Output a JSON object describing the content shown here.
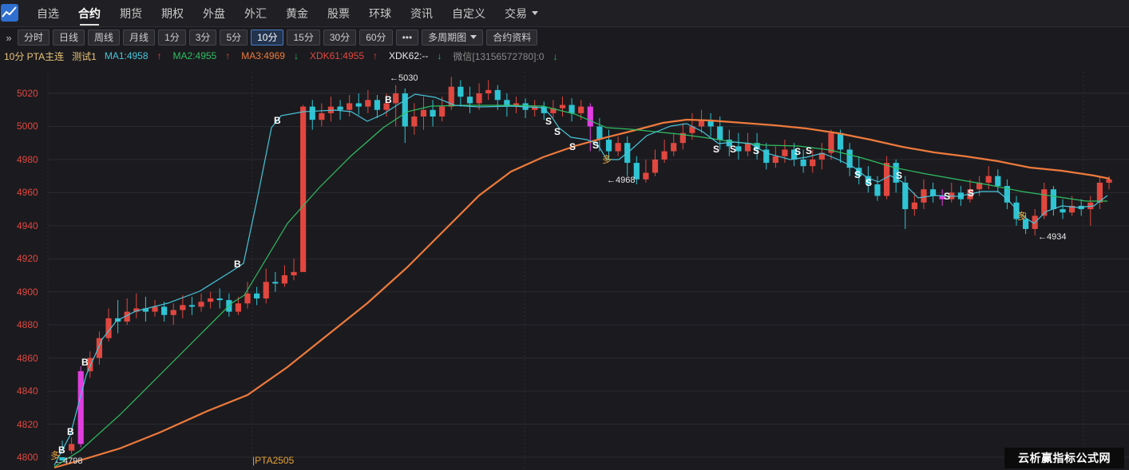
{
  "nav": {
    "items": [
      "自选",
      "合约",
      "期货",
      "期权",
      "外盘",
      "外汇",
      "黄金",
      "股票",
      "环球",
      "资讯",
      "自定义",
      "交易"
    ],
    "active": "合约"
  },
  "toolbar": {
    "periods": [
      "分时",
      "日线",
      "周线",
      "月线",
      "1分",
      "3分",
      "5分",
      "10分",
      "15分",
      "30分",
      "60分"
    ],
    "active_period": "10分",
    "more": "•••",
    "multi_period": "多周期图",
    "contract_info": "合约资料"
  },
  "indicator": {
    "title": "10分 PTA主连",
    "test": "测试1",
    "ma1": "MA1:4958",
    "ma2": "MA2:4955",
    "ma3": "MA3:4969",
    "xdk61": "XDK61:4955",
    "xdk62": "XDK62:--",
    "wechat": "微信[13156572780]:0"
  },
  "colors": {
    "up": "#e0473f",
    "down": "#2ec4d4",
    "ma1": "#48c4d8",
    "ma2": "#2fbf62",
    "ma3": "#ee7a3c",
    "magenta": "#e13ee0",
    "signal_yellow": "#e6a13a"
  },
  "annotations": {
    "high": "←5030",
    "low_left": "←4798",
    "low_mid": "←4968",
    "low_right": "←4934"
  },
  "contract_tag": "PTA2505",
  "watermark": "云析赢指标公式网",
  "chart_data": {
    "type": "candlestick",
    "ylim": [
      4795,
      5035
    ],
    "yticks": [
      4800,
      4820,
      4840,
      4860,
      4880,
      4900,
      4920,
      4940,
      4960,
      4980,
      5000,
      5020
    ],
    "candles": [
      [
        4800,
        4798,
        4804,
        4810
      ],
      [
        4804,
        4808,
        4802,
        4812
      ],
      [
        4808,
        4852,
        4806,
        4855
      ],
      [
        4852,
        4860,
        4848,
        4864
      ],
      [
        4860,
        4872,
        4856,
        4876
      ],
      [
        4872,
        4884,
        4870,
        4890
      ],
      [
        4884,
        4882,
        4875,
        4895
      ],
      [
        4882,
        4888,
        4880,
        4896
      ],
      [
        4888,
        4890,
        4884,
        4899
      ],
      [
        4890,
        4888,
        4882,
        4897
      ],
      [
        4888,
        4891,
        4885,
        4895
      ],
      [
        4891,
        4886,
        4882,
        4894
      ],
      [
        4886,
        4889,
        4880,
        4893
      ],
      [
        4889,
        4892,
        4884,
        4898
      ],
      [
        4892,
        4891,
        4886,
        4897
      ],
      [
        4891,
        4894,
        4888,
        4899
      ],
      [
        4894,
        4896,
        4890,
        4900
      ],
      [
        4896,
        4895,
        4890,
        4902
      ],
      [
        4895,
        4888,
        4885,
        4899
      ],
      [
        4888,
        4893,
        4886,
        4897
      ],
      [
        4893,
        4899,
        4890,
        4906
      ],
      [
        4899,
        4896,
        4892,
        4903
      ],
      [
        4896,
        4906,
        4893,
        4914
      ],
      [
        4906,
        4905,
        4900,
        4912
      ],
      [
        4905,
        4910,
        4903,
        4916
      ],
      [
        4910,
        4912,
        4907,
        4920
      ],
      [
        4912,
        5012,
        4985,
        5013
      ],
      [
        5012,
        5004,
        4998,
        5016
      ],
      [
        5004,
        5008,
        5000,
        5014
      ],
      [
        5008,
        5012,
        5003,
        5018
      ],
      [
        5012,
        5010,
        5004,
        5016
      ],
      [
        5010,
        5014,
        5006,
        5019
      ],
      [
        5014,
        5012,
        5007,
        5020
      ],
      [
        5012,
        5016,
        5008,
        5022
      ],
      [
        5016,
        5010,
        5005,
        5019
      ],
      [
        5010,
        5014,
        5006,
        5020
      ],
      [
        5014,
        5020,
        5000,
        5025
      ],
      [
        5020,
        5000,
        4990,
        5023
      ],
      [
        5000,
        5006,
        4995,
        5014
      ],
      [
        5006,
        5010,
        4998,
        5018
      ],
      [
        5010,
        5006,
        5000,
        5016
      ],
      [
        5006,
        5012,
        5003,
        5018
      ],
      [
        5012,
        5024,
        5010,
        5030
      ],
      [
        5024,
        5018,
        5012,
        5028
      ],
      [
        5018,
        5014,
        5008,
        5024
      ],
      [
        5014,
        5020,
        5010,
        5026
      ],
      [
        5020,
        5022,
        5016,
        5028
      ],
      [
        5022,
        5016,
        5010,
        5025
      ],
      [
        5016,
        5012,
        5006,
        5020
      ],
      [
        5012,
        5014,
        5008,
        5018
      ],
      [
        5014,
        5010,
        5005,
        5017
      ],
      [
        5010,
        5012,
        5006,
        5016
      ],
      [
        5012,
        5008,
        5004,
        5015
      ],
      [
        5008,
        5011,
        5005,
        5016
      ],
      [
        5011,
        5013,
        5006,
        5018
      ],
      [
        5013,
        5008,
        5003,
        5017
      ],
      [
        5008,
        5012,
        5004,
        5016
      ],
      [
        5012,
        5000,
        4985,
        5014
      ],
      [
        5000,
        4992,
        4985,
        5005
      ],
      [
        4992,
        4985,
        4980,
        4998
      ],
      [
        4985,
        4990,
        4982,
        4994
      ],
      [
        4990,
        4978,
        4970,
        4994
      ],
      [
        4978,
        4968,
        4965,
        4982
      ],
      [
        4968,
        4972,
        4966,
        4980
      ],
      [
        4972,
        4980,
        4970,
        4986
      ],
      [
        4980,
        4985,
        4978,
        4992
      ],
      [
        4985,
        4990,
        4982,
        4996
      ],
      [
        4990,
        4996,
        4986,
        5002
      ],
      [
        4996,
        5000,
        4992,
        5008
      ],
      [
        5000,
        5004,
        4996,
        5010
      ],
      [
        5004,
        5000,
        4994,
        5008
      ],
      [
        5000,
        4992,
        4986,
        5006
      ],
      [
        4992,
        4988,
        4982,
        4998
      ],
      [
        4988,
        4985,
        4980,
        4996
      ],
      [
        4985,
        4990,
        4982,
        4996
      ],
      [
        4990,
        4986,
        4980,
        4996
      ],
      [
        4986,
        4978,
        4974,
        4990
      ],
      [
        4978,
        4982,
        4975,
        4988
      ],
      [
        4982,
        4986,
        4978,
        4992
      ],
      [
        4986,
        4980,
        4976,
        4990
      ],
      [
        4980,
        4976,
        4972,
        4986
      ],
      [
        4976,
        4980,
        4972,
        4986
      ],
      [
        4980,
        4984,
        4974,
        4990
      ],
      [
        4984,
        4996,
        4980,
        4998
      ],
      [
        4996,
        4986,
        4978,
        4998
      ],
      [
        4986,
        4975,
        4970,
        4990
      ],
      [
        4975,
        4970,
        4965,
        4982
      ],
      [
        4970,
        4965,
        4960,
        4976
      ],
      [
        4965,
        4958,
        4955,
        4970
      ],
      [
        4958,
        4978,
        4956,
        4982
      ],
      [
        4978,
        4966,
        4960,
        4980
      ],
      [
        4966,
        4950,
        4938,
        4970
      ],
      [
        4950,
        4954,
        4946,
        4960
      ],
      [
        4954,
        4962,
        4950,
        4968
      ],
      [
        4962,
        4958,
        4954,
        4966
      ],
      [
        4958,
        4956,
        4952,
        4962
      ],
      [
        4956,
        4960,
        4954,
        4966
      ],
      [
        4960,
        4956,
        4952,
        4964
      ],
      [
        4956,
        4962,
        4954,
        4968
      ],
      [
        4962,
        4966,
        4958,
        4970
      ],
      [
        4966,
        4970,
        4962,
        4976
      ],
      [
        4970,
        4964,
        4960,
        4974
      ],
      [
        4964,
        4954,
        4950,
        4968
      ],
      [
        4954,
        4944,
        4940,
        4958
      ],
      [
        4944,
        4938,
        4935,
        4948
      ],
      [
        4938,
        4946,
        4934,
        4950
      ],
      [
        4946,
        4962,
        4944,
        4966
      ],
      [
        4962,
        4950,
        4946,
        4964
      ],
      [
        4950,
        4948,
        4944,
        4956
      ],
      [
        4948,
        4952,
        4946,
        4958
      ],
      [
        4952,
        4950,
        4946,
        4956
      ],
      [
        4950,
        4954,
        4940,
        4958
      ],
      [
        4954,
        4966,
        4950,
        4970
      ],
      [
        4966,
        4968,
        4962,
        4970
      ]
    ],
    "ma1_path": [
      [
        68,
        583
      ],
      [
        88,
        545
      ],
      [
        108,
        470
      ],
      [
        128,
        425
      ],
      [
        146,
        402
      ],
      [
        170,
        390
      ],
      [
        210,
        380
      ],
      [
        250,
        365
      ],
      [
        290,
        340
      ],
      [
        305,
        330
      ],
      [
        322,
        250
      ],
      [
        340,
        160
      ],
      [
        352,
        145
      ],
      [
        380,
        140
      ],
      [
        420,
        138
      ],
      [
        440,
        140
      ],
      [
        460,
        152
      ],
      [
        480,
        143
      ],
      [
        500,
        130
      ],
      [
        520,
        118
      ],
      [
        545,
        122
      ],
      [
        570,
        132
      ],
      [
        600,
        134
      ],
      [
        640,
        133
      ],
      [
        680,
        135
      ],
      [
        690,
        145
      ],
      [
        700,
        160
      ],
      [
        715,
        172
      ],
      [
        735,
        175
      ],
      [
        748,
        180
      ],
      [
        760,
        200
      ],
      [
        775,
        200
      ],
      [
        790,
        188
      ],
      [
        810,
        170
      ],
      [
        840,
        158
      ],
      [
        860,
        155
      ],
      [
        880,
        165
      ],
      [
        900,
        180
      ],
      [
        920,
        178
      ],
      [
        940,
        180
      ],
      [
        960,
        192
      ],
      [
        990,
        200
      ],
      [
        1010,
        197
      ],
      [
        1030,
        192
      ],
      [
        1050,
        200
      ],
      [
        1070,
        210
      ],
      [
        1085,
        222
      ],
      [
        1100,
        228
      ],
      [
        1115,
        220
      ],
      [
        1130,
        228
      ],
      [
        1150,
        248
      ],
      [
        1170,
        245
      ],
      [
        1200,
        246
      ],
      [
        1230,
        240
      ],
      [
        1250,
        240
      ],
      [
        1262,
        250
      ],
      [
        1280,
        270
      ],
      [
        1295,
        280
      ],
      [
        1310,
        265
      ],
      [
        1330,
        258
      ],
      [
        1350,
        260
      ],
      [
        1370,
        258
      ],
      [
        1387,
        245
      ]
    ],
    "ma2_path": [
      [
        68,
        585
      ],
      [
        100,
        565
      ],
      [
        150,
        520
      ],
      [
        200,
        470
      ],
      [
        250,
        420
      ],
      [
        290,
        380
      ],
      [
        306,
        370
      ],
      [
        330,
        330
      ],
      [
        360,
        280
      ],
      [
        400,
        235
      ],
      [
        440,
        195
      ],
      [
        480,
        160
      ],
      [
        510,
        140
      ],
      [
        540,
        133
      ],
      [
        580,
        132
      ],
      [
        640,
        132
      ],
      [
        680,
        133
      ],
      [
        720,
        143
      ],
      [
        760,
        160
      ],
      [
        790,
        162
      ],
      [
        820,
        165
      ],
      [
        850,
        168
      ],
      [
        880,
        172
      ],
      [
        920,
        178
      ],
      [
        960,
        182
      ],
      [
        1000,
        183
      ],
      [
        1040,
        188
      ],
      [
        1080,
        198
      ],
      [
        1120,
        210
      ],
      [
        1160,
        218
      ],
      [
        1200,
        225
      ],
      [
        1240,
        232
      ],
      [
        1280,
        240
      ],
      [
        1320,
        246
      ],
      [
        1360,
        252
      ],
      [
        1387,
        252
      ]
    ],
    "ma3_path": [
      [
        68,
        586
      ],
      [
        100,
        577
      ],
      [
        150,
        562
      ],
      [
        200,
        542
      ],
      [
        260,
        515
      ],
      [
        310,
        495
      ],
      [
        360,
        460
      ],
      [
        410,
        420
      ],
      [
        460,
        380
      ],
      [
        510,
        335
      ],
      [
        560,
        285
      ],
      [
        600,
        245
      ],
      [
        640,
        215
      ],
      [
        680,
        197
      ],
      [
        720,
        183
      ],
      [
        760,
        172
      ],
      [
        800,
        162
      ],
      [
        830,
        154
      ],
      [
        860,
        150
      ],
      [
        890,
        151
      ],
      [
        930,
        154
      ],
      [
        970,
        157
      ],
      [
        1010,
        161
      ],
      [
        1050,
        167
      ],
      [
        1090,
        175
      ],
      [
        1130,
        184
      ],
      [
        1170,
        191
      ],
      [
        1210,
        196
      ],
      [
        1250,
        202
      ],
      [
        1290,
        210
      ],
      [
        1330,
        214
      ],
      [
        1370,
        220
      ],
      [
        1390,
        224
      ]
    ],
    "signals_b": [
      [
        77,
        565
      ],
      [
        88,
        542
      ],
      [
        106,
        455
      ],
      [
        297,
        332
      ],
      [
        347,
        152
      ],
      [
        486,
        126
      ]
    ],
    "signals_s": [
      [
        687,
        153
      ],
      [
        698,
        166
      ],
      [
        717,
        185
      ],
      [
        746,
        183
      ],
      [
        897,
        188
      ],
      [
        918,
        188
      ],
      [
        947,
        190
      ],
      [
        999,
        191
      ],
      [
        1013,
        190
      ],
      [
        1074,
        220
      ],
      [
        1088,
        230
      ],
      [
        1126,
        221
      ],
      [
        1186,
        247
      ],
      [
        1216,
        243
      ]
    ],
    "signals_yellow": [
      [
        67,
        570
      ],
      [
        758,
        199
      ],
      [
        1278,
        270
      ]
    ]
  }
}
